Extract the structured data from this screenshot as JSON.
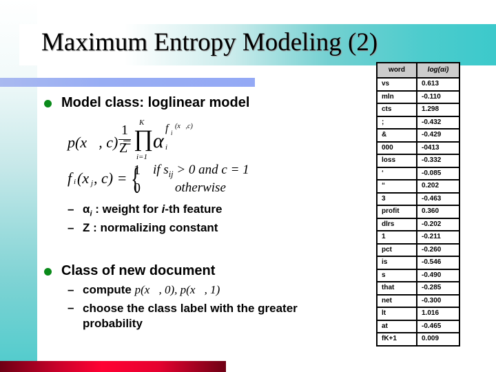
{
  "slide": {
    "title": "Maximum Entropy Modeling (2)",
    "colors": {
      "accent_teal": "#4ccccd",
      "blue_bar": "#98adf4",
      "red_bar": "#ff0033",
      "bullet_green": "#0a8a1a",
      "header_gray": "#cccccc"
    }
  },
  "content": {
    "bullet1": "Model class: loglinear model",
    "formula1": {
      "lhs": "p(x⃗, c) =",
      "frac_num": "1",
      "frac_den": "Z",
      "prod_symbol": "∏",
      "prod_upper": "K",
      "prod_lower": "i=1",
      "base": "α",
      "base_sub": "i",
      "exponent": "f",
      "exponent_sub": "i",
      "exponent_args": "(x⃗,c)"
    },
    "formula2": {
      "lhs": "f",
      "lhs_sub": "i",
      "lhs_args": "(x⃗",
      "lhs_args_sub": "j",
      "lhs_args_end": ", c) =",
      "case1_value": "1",
      "case1_cond": "if  s",
      "case1_cond_sub": "ij",
      "case1_cond_end": " > 0 and c = 1",
      "case2_value": "0",
      "case2_cond": "otherwise"
    },
    "sub1": {
      "symbol": "α",
      "symbol_sub": "i",
      "text_a": " : weight for ",
      "text_i": "i",
      "text_b": "-th feature"
    },
    "sub2": "Z : normalizing constant",
    "bullet2": "Class of new document",
    "sub3": {
      "prefix": "compute ",
      "math": "p(x⃗, 0),  p(x⃗, 1)"
    },
    "sub4_line1": "choose the class label with the greater",
    "sub4_line2": "probability",
    "dash": "–"
  },
  "table": {
    "headers": [
      "word",
      "log(αi)"
    ],
    "rows": [
      [
        "vs",
        "0.613"
      ],
      [
        "mln",
        "-0.110"
      ],
      [
        "cts",
        "1.298"
      ],
      [
        ";",
        "-0.432"
      ],
      [
        "&",
        "-0.429"
      ],
      [
        "000",
        "-0413"
      ],
      [
        "loss",
        "-0.332"
      ],
      [
        "‘",
        "-0.085"
      ],
      [
        "“",
        "0.202"
      ],
      [
        "3",
        "-0.463"
      ],
      [
        "profit",
        "0.360"
      ],
      [
        "dlrs",
        "-0.202"
      ],
      [
        "1",
        "-0.211"
      ],
      [
        "pct",
        "-0.260"
      ],
      [
        "is",
        "-0.546"
      ],
      [
        "s",
        "-0.490"
      ],
      [
        "that",
        "-0.285"
      ],
      [
        "net",
        "-0.300"
      ],
      [
        "lt",
        "1.016"
      ],
      [
        "at",
        "-0.465"
      ],
      [
        "fK+1",
        "0.009"
      ]
    ]
  }
}
